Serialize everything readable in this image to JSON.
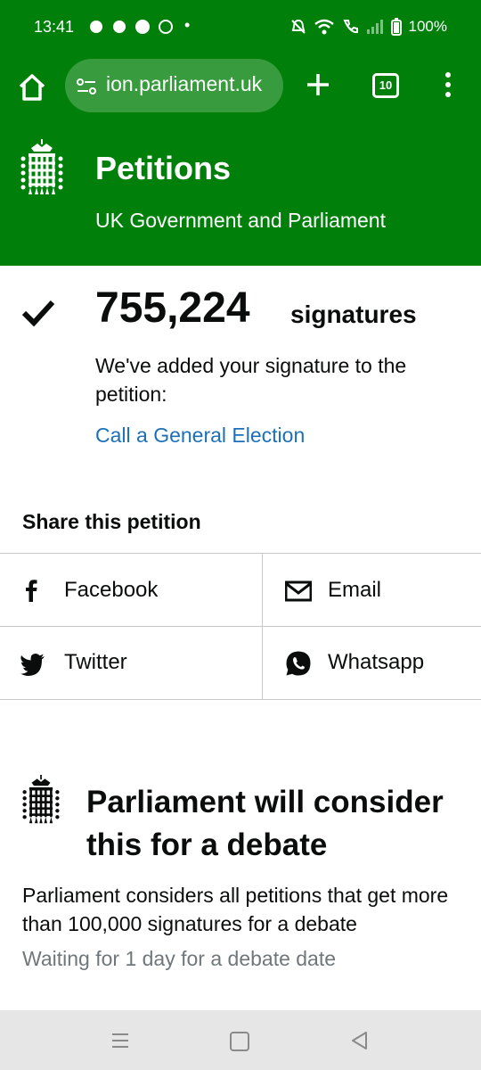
{
  "status_bar": {
    "time": "13:41",
    "notifications": "•",
    "battery": "100%"
  },
  "browser": {
    "url": "ion.parliament.uk",
    "tab_count": "10"
  },
  "header": {
    "title": "Petitions",
    "subtitle": "UK Government and Parliament"
  },
  "confirmation": {
    "count": "755,224",
    "count_label": "signatures",
    "message": "We've added your signature to the petition:",
    "petition_link": "Call a General Election"
  },
  "share": {
    "title": "Share this petition",
    "facebook": "Facebook",
    "email": "Email",
    "twitter": "Twitter",
    "whatsapp": "Whatsapp"
  },
  "debate": {
    "title": "Parliament will consider this for a debate",
    "text": "Parliament considers all petitions that get more than 100,000 signatures for a debate",
    "waiting": "Waiting for 1 day for a debate date"
  },
  "colors": {
    "brand_green": "#00800a",
    "link_blue": "#1d70b8",
    "muted": "#6f777b"
  }
}
